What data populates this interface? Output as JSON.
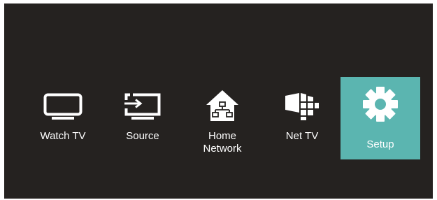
{
  "menu": {
    "selected_index": 4,
    "items": [
      {
        "label": "Watch TV",
        "icon": "tv-icon"
      },
      {
        "label": "Source",
        "icon": "source-input-icon"
      },
      {
        "label": "Home\nNetwork",
        "icon": "home-network-icon"
      },
      {
        "label": "Net TV",
        "icon": "net-tv-icon"
      },
      {
        "label": "Setup",
        "icon": "gear-icon"
      }
    ]
  },
  "colors": {
    "background": "#252220",
    "selected": "#5bb5b0",
    "foreground": "#ffffff"
  }
}
